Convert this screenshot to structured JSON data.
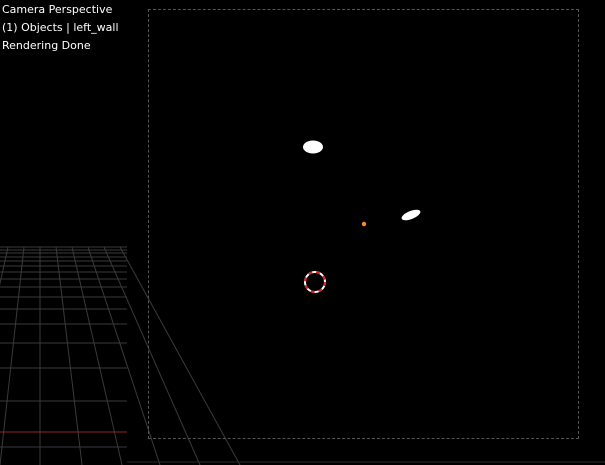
{
  "viewport": {
    "header_lines": [
      "Camera Perspective",
      "(1) Objects | left_wall",
      "Rendering Done"
    ]
  },
  "colors": {
    "background": "#000000",
    "grid_line": "#3a3a3a",
    "x_axis": "#8a2a2a",
    "origin": "#ff8a1f",
    "cursor_red": "#e02020",
    "cursor_white": "#ffffff",
    "light_blob": "#ffffff",
    "camera_border": "#555555"
  }
}
